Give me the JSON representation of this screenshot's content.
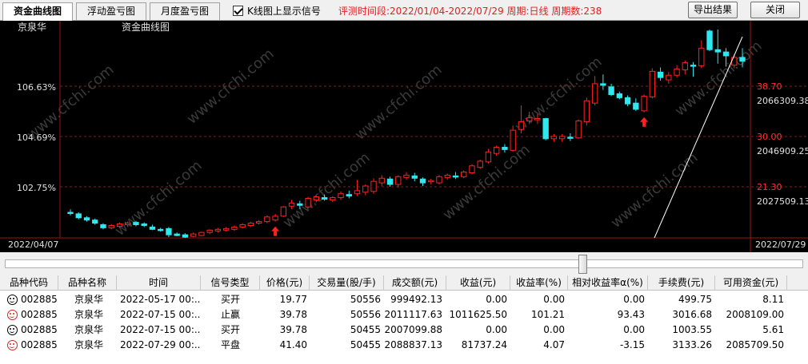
{
  "tabs": [
    {
      "label": "资金曲线图",
      "active": true
    },
    {
      "label": "浮动盈亏图",
      "active": false
    },
    {
      "label": "月度盈亏图",
      "active": false
    }
  ],
  "option": {
    "label": "K线图上显示信号",
    "checked": true
  },
  "info": "评测时间段:2022/01/04-2022/07/29 周期:日线 周期数:238",
  "buttons": {
    "export": "导出结果",
    "close": "关闭"
  },
  "chart": {
    "stock_name": "京泉华",
    "curve_title": "资金曲线图",
    "left_labels": [
      "106.63%",
      "104.69%",
      "102.75%"
    ],
    "right_price_labels": [
      "38.70",
      "30.00",
      "21.30"
    ],
    "right_capital_labels": [
      "2066309.38",
      "2046909.25",
      "2027509.13"
    ],
    "date_start": "2022/04/07",
    "date_end": "2022/07/29",
    "watermark": "www.cfchi.com",
    "colors": {
      "up": "#ff2020",
      "down": "#2ee8f0",
      "grid": "#a01010",
      "curve": "#ffffff"
    }
  },
  "chart_data": {
    "type": "candlestick",
    "ylim": [
      17.5,
      44.5
    ],
    "candles": [
      [
        20.8,
        21.2,
        20.4,
        20.7
      ],
      [
        20.6,
        20.8,
        19.9,
        20.1
      ],
      [
        20.1,
        20.3,
        19.6,
        19.8
      ],
      [
        19.8,
        20.0,
        19.2,
        19.4
      ],
      [
        19.2,
        19.4,
        18.6,
        18.8
      ],
      [
        18.8,
        19.3,
        18.6,
        19.1
      ],
      [
        19.0,
        19.5,
        18.8,
        19.3
      ],
      [
        19.2,
        19.6,
        18.9,
        19.4
      ],
      [
        19.5,
        19.7,
        19.0,
        19.2
      ],
      [
        19.3,
        19.5,
        18.9,
        19.1
      ],
      [
        18.9,
        19.2,
        18.5,
        18.6
      ],
      [
        18.6,
        18.8,
        18.3,
        18.5
      ],
      [
        18.7,
        18.9,
        17.6,
        17.9
      ],
      [
        18.0,
        18.2,
        17.7,
        17.8
      ],
      [
        17.9,
        18.1,
        17.5,
        17.6
      ],
      [
        17.7,
        18.2,
        17.6,
        18.0
      ],
      [
        17.8,
        18.3,
        17.7,
        18.2
      ],
      [
        18.2,
        18.6,
        18.0,
        18.5
      ],
      [
        18.4,
        18.8,
        18.2,
        18.6
      ],
      [
        18.5,
        18.9,
        18.3,
        18.7
      ],
      [
        18.6,
        19.1,
        18.4,
        18.9
      ],
      [
        18.9,
        19.4,
        18.7,
        19.2
      ],
      [
        19.1,
        19.6,
        18.9,
        19.4
      ],
      [
        19.4,
        19.8,
        19.2,
        19.6
      ],
      [
        19.6,
        20.4,
        19.4,
        20.2
      ],
      [
        19.8,
        20.6,
        19.6,
        20.3
      ],
      [
        20.3,
        21.6,
        20.2,
        21.5
      ],
      [
        21.6,
        22.4,
        21.2,
        22.0
      ],
      [
        21.9,
        22.3,
        21.2,
        21.7
      ],
      [
        21.5,
        22.8,
        21.3,
        22.6
      ],
      [
        22.4,
        23.0,
        22.1,
        22.8
      ],
      [
        22.7,
        23.1,
        22.3,
        22.5
      ],
      [
        22.4,
        22.9,
        22.1,
        22.7
      ],
      [
        22.7,
        23.5,
        22.4,
        23.2
      ],
      [
        23.1,
        23.6,
        22.6,
        22.9
      ],
      [
        23.2,
        25.0,
        22.9,
        23.6
      ],
      [
        23.4,
        24.4,
        23.0,
        24.2
      ],
      [
        23.5,
        25.2,
        23.2,
        24.8
      ],
      [
        24.6,
        25.6,
        24.2,
        25.2
      ],
      [
        25.1,
        25.4,
        24.1,
        24.4
      ],
      [
        24.4,
        25.6,
        24.0,
        25.4
      ],
      [
        25.3,
        26.0,
        25.0,
        25.6
      ],
      [
        25.5,
        25.9,
        24.8,
        25.2
      ],
      [
        25.1,
        25.3,
        24.2,
        24.6
      ],
      [
        24.8,
        25.1,
        24.4,
        24.9
      ],
      [
        24.6,
        25.6,
        24.4,
        25.4
      ],
      [
        25.3,
        25.8,
        25.0,
        25.6
      ],
      [
        25.5,
        26.0,
        25.1,
        25.4
      ],
      [
        25.4,
        26.2,
        25.2,
        26.0
      ],
      [
        25.9,
        27.0,
        25.7,
        26.8
      ],
      [
        26.6,
        27.6,
        26.4,
        27.4
      ],
      [
        27.3,
        29.0,
        27.1,
        28.6
      ],
      [
        28.4,
        29.4,
        28.1,
        29.2
      ],
      [
        29.2,
        29.6,
        28.5,
        28.9
      ],
      [
        28.8,
        32.0,
        28.6,
        31.4
      ],
      [
        31.5,
        34.6,
        31.0,
        32.5
      ],
      [
        32.6,
        33.8,
        32.2,
        33.0
      ],
      [
        32.8,
        33.5,
        32.2,
        32.9
      ],
      [
        32.9,
        33.0,
        30.1,
        30.3
      ],
      [
        30.3,
        30.9,
        29.9,
        30.6
      ],
      [
        30.3,
        30.9,
        29.9,
        30.6
      ],
      [
        30.5,
        31.0,
        30.0,
        30.4
      ],
      [
        30.4,
        32.8,
        30.3,
        32.6
      ],
      [
        32.5,
        35.6,
        32.0,
        35.2
      ],
      [
        34.9,
        38.4,
        34.6,
        37.4
      ],
      [
        37.4,
        38.6,
        36.6,
        37.2
      ],
      [
        37.0,
        37.4,
        35.8,
        36.0
      ],
      [
        36.1,
        36.4,
        35.4,
        35.6
      ],
      [
        35.6,
        35.9,
        34.5,
        34.8
      ],
      [
        34.9,
        35.5,
        33.9,
        34.1
      ],
      [
        33.9,
        36.0,
        33.7,
        35.8
      ],
      [
        35.7,
        39.4,
        35.5,
        39.0
      ],
      [
        38.9,
        39.5,
        37.8,
        38.2
      ],
      [
        37.9,
        38.9,
        37.4,
        38.5
      ],
      [
        38.5,
        39.8,
        38.2,
        39.3
      ],
      [
        39.2,
        40.4,
        38.6,
        40.1
      ],
      [
        39.8,
        40.2,
        38.3,
        39.7
      ],
      [
        39.7,
        43.0,
        39.4,
        42.0
      ],
      [
        44.2,
        44.4,
        41.6,
        41.8
      ],
      [
        41.8,
        44.4,
        40.0,
        41.5
      ],
      [
        41.5,
        42.0,
        39.6,
        41.0
      ],
      [
        39.8,
        41.2,
        39.4,
        40.8
      ],
      [
        40.8,
        42.0,
        39.5,
        40.3
      ]
    ],
    "signals": [
      {
        "index": 25,
        "type": "buy"
      },
      {
        "index": 70,
        "type": "buy"
      }
    ]
  },
  "slider": {
    "position": 0.72
  },
  "table": {
    "headers": [
      "品种代码",
      "品种名称",
      "时间",
      "信号类型",
      "价格(元)",
      "交易量(股/手)",
      "成交额(元)",
      "收益(元)",
      "收益率(%)",
      "相对收益率α(%)",
      "手续费(元)",
      "可用资金(元)"
    ],
    "rows": [
      {
        "icon": "smile",
        "code": "002885",
        "name": "京泉华",
        "time": "2022-05-17 00:...",
        "signal": "买开",
        "price": "19.77",
        "volume": "50556",
        "turnover": "999492.13",
        "profit": "0.00",
        "rate": "0.00",
        "alpha": "0.00",
        "fee": "499.75",
        "cash": "8.11"
      },
      {
        "icon": "smile-red",
        "code": "002885",
        "name": "京泉华",
        "time": "2022-07-15 00:...",
        "signal": "止赢",
        "price": "39.78",
        "volume": "50556",
        "turnover": "2011117.63",
        "profit": "1011625.50",
        "rate": "101.21",
        "alpha": "93.43",
        "fee": "3016.68",
        "cash": "2008109.00"
      },
      {
        "icon": "smile",
        "code": "002885",
        "name": "京泉华",
        "time": "2022-07-15 00:...",
        "signal": "买开",
        "price": "39.78",
        "volume": "50455",
        "turnover": "2007099.88",
        "profit": "0.00",
        "rate": "0.00",
        "alpha": "0.00",
        "fee": "1003.55",
        "cash": "5.61"
      },
      {
        "icon": "smile-red",
        "code": "002885",
        "name": "京泉华",
        "time": "2022-07-29 00:...",
        "signal": "平盘",
        "price": "41.40",
        "volume": "50455",
        "turnover": "2088837.13",
        "profit": "81737.24",
        "rate": "4.07",
        "alpha": "-3.15",
        "fee": "3133.26",
        "cash": "2085709.50"
      }
    ]
  }
}
